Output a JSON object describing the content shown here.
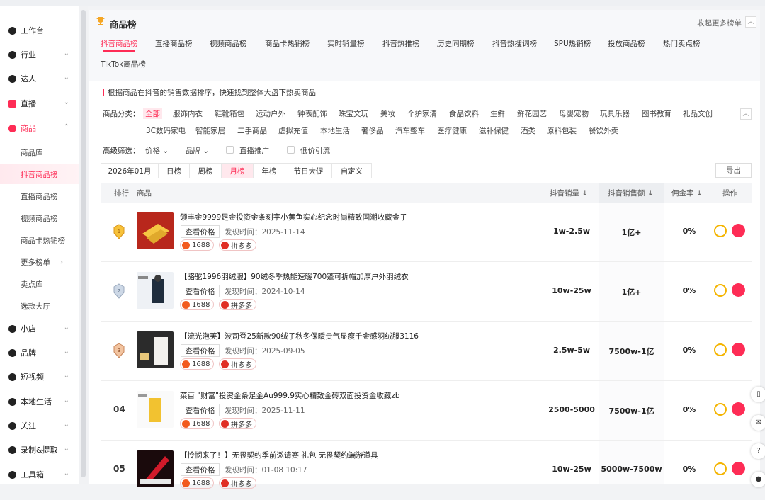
{
  "sidebar": {
    "items": [
      {
        "label": "工作台",
        "chev": ""
      },
      {
        "label": "行业",
        "chev": "⌄"
      },
      {
        "label": "达人",
        "chev": "⌄"
      },
      {
        "label": "直播",
        "chev": "⌄"
      },
      {
        "label": "商品",
        "chev": "⌃"
      }
    ],
    "sub": [
      {
        "label": "商品库"
      },
      {
        "label": "抖音商品榜"
      },
      {
        "label": "直播商品榜"
      },
      {
        "label": "视频商品榜"
      },
      {
        "label": "商品卡热销榜"
      },
      {
        "label": "更多榜单"
      },
      {
        "label": "卖点库"
      },
      {
        "label": "选款大厅"
      }
    ],
    "items2": [
      {
        "label": "小店"
      },
      {
        "label": "品牌"
      },
      {
        "label": "短视频"
      },
      {
        "label": "本地生活"
      },
      {
        "label": "关注"
      },
      {
        "label": "录制&提取"
      },
      {
        "label": "工具箱"
      }
    ]
  },
  "header": {
    "title": "商品榜",
    "collapse_text": "收起更多榜单",
    "tabs": [
      "抖音商品榜",
      "直播商品榜",
      "视频商品榜",
      "商品卡热销榜",
      "实时销量榜",
      "抖音热推榜",
      "历史同期榜",
      "抖音热搜词榜",
      "SPU热销榜",
      "投放商品榜",
      "热门卖点榜",
      "TikTok商品榜"
    ]
  },
  "description": "根据商品在抖音的销售数据排序，快速找到整体大盘下热卖商品",
  "category": {
    "label": "商品分类：",
    "items": [
      "全部",
      "服饰内衣",
      "鞋靴箱包",
      "运动户外",
      "钟表配饰",
      "珠宝文玩",
      "美妆",
      "个护家清",
      "食品饮料",
      "生鲜",
      "鲜花园艺",
      "母婴宠物",
      "玩具乐器",
      "图书教育",
      "礼品文创",
      "3C数码家电",
      "智能家居",
      "二手商品",
      "虚拟充值",
      "本地生活",
      "奢侈品",
      "汽车整车",
      "医疗健康",
      "滋补保健",
      "酒类",
      "原料包装",
      "餐饮外卖"
    ]
  },
  "filter": {
    "label": "高级筛选：",
    "price": "价格",
    "brand": "品牌",
    "live_promo": "直播推广",
    "low_price": "低价引流"
  },
  "period_tabs": [
    "2026年01月",
    "日榜",
    "周榜",
    "月榜",
    "年榜",
    "节日大促",
    "自定义"
  ],
  "export": "导出",
  "table": {
    "headers": {
      "rank": "排行",
      "product": "商品",
      "sales": "抖音销量",
      "gmv": "抖音销售额",
      "commission": "佣金率",
      "action": "操作"
    },
    "check_price": "查看价格",
    "platform1": "1688",
    "platform2": "拼多多",
    "rows": [
      {
        "rank": "1",
        "name": "领丰金9999足金投资金条刻字小黄鱼实心纪念时尚精致国潮收藏金子",
        "time": "发现时间：2025-11-14",
        "sales": "1w-2.5w",
        "gmv": "1亿+",
        "commission": "0%"
      },
      {
        "rank": "2",
        "name": "【骆驼1996羽绒服】90绒冬季热能速暖700蓬可拆帽加厚户外羽绒衣",
        "time": "发现时间：2024-10-14",
        "sales": "10w-25w",
        "gmv": "1亿+",
        "commission": "0%"
      },
      {
        "rank": "3",
        "name": "【流光泡芙】波司登25新款90绒子秋冬保暖贵气显瘦千金感羽绒服3116",
        "time": "发现时间：2025-09-05",
        "sales": "2.5w-5w",
        "gmv": "7500w-1亿",
        "commission": "0%"
      },
      {
        "rank": "04",
        "name": "菜百 \"财富\"投资金条足金Au999.9实心精致金砖双面投资金收藏zb",
        "time": "发现时间：2025-11-11",
        "sales": "2500-5000",
        "gmv": "7500w-1亿",
        "commission": "0%"
      },
      {
        "rank": "05",
        "name": "【怜悯来了！】无畏契约季前邀请赛 礼包 无畏契约端游道具",
        "time": "发现时间：01-08 10:17",
        "sales": "10w-25w",
        "gmv": "5000w-7500w",
        "commission": "0%"
      }
    ]
  },
  "colors": {
    "accent": "#fe2c55"
  }
}
